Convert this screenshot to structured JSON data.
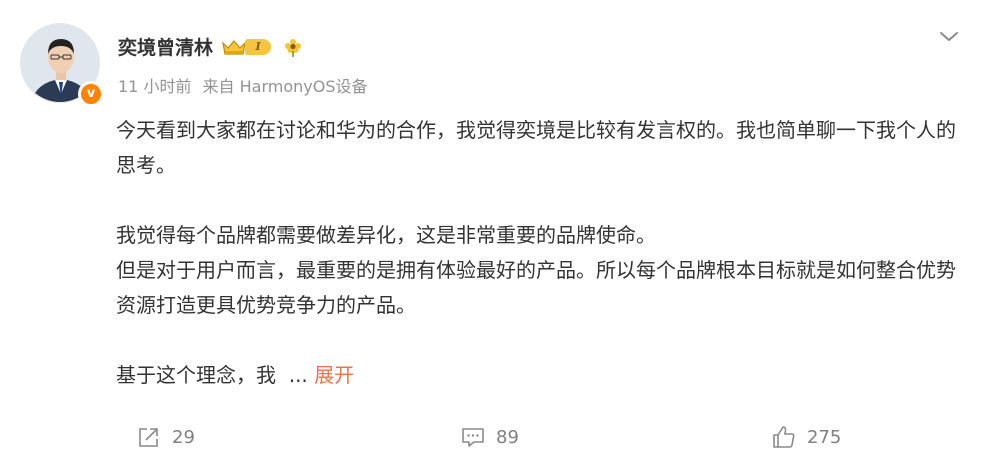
{
  "author": {
    "name": "奕境曾清林",
    "vip_level_text": "I",
    "verified_mark": "v"
  },
  "meta": {
    "time": "11 小时前",
    "source": "来自 HarmonyOS设备"
  },
  "content": {
    "paragraph1": "今天看到大家都在讨论和华为的合作，我觉得奕境是比较有发言权的。我也简单聊一下我个人的思考。",
    "paragraph2_line1": "我觉得每个品牌都需要做差异化，这是非常重要的品牌使命。",
    "paragraph2_line2": "但是对于用户而言，最重要的是拥有体验最好的产品。所以每个品牌根本目标就是如何整合优势资源打造更具优势竞争力的产品。",
    "paragraph3": "基于这个理念，我  ... ",
    "expand_label": "展开"
  },
  "actions": {
    "share_count": "29",
    "comment_count": "89",
    "like_count": "275"
  },
  "colors": {
    "accent_link": "#eb7350",
    "verified_orange": "#ff8200",
    "meta_gray": "#939393"
  },
  "icons": [
    "crown-icon",
    "flower-icon",
    "chevron-down-icon",
    "share-icon",
    "comment-icon",
    "like-icon",
    "verified-icon"
  ]
}
